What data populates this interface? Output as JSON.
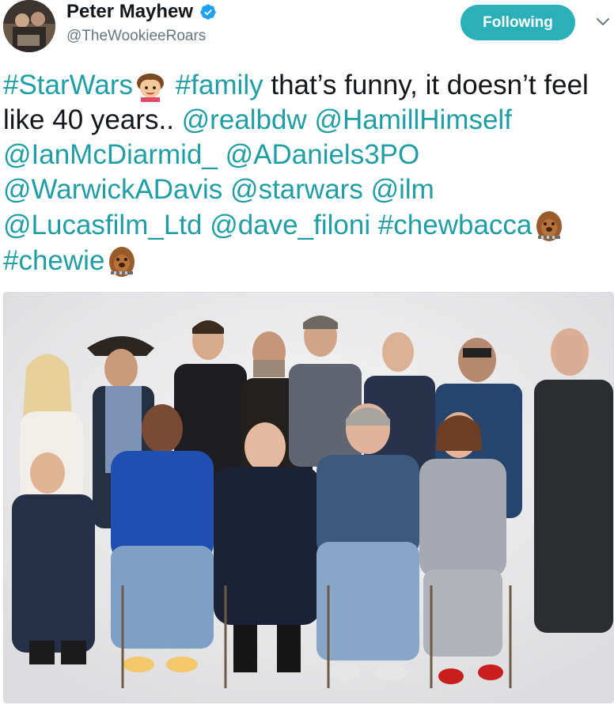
{
  "author": {
    "display_name": "Peter Mayhew",
    "handle": "@TheWookieeRoars",
    "verified": true,
    "avatar_icon": "profile-photo"
  },
  "actions": {
    "follow_label": "Following",
    "more_icon": "chevron-down-icon"
  },
  "tweet": {
    "segments": [
      {
        "type": "hashtag",
        "text": "#StarWars"
      },
      {
        "type": "emoji",
        "name": "boy-emoji"
      },
      {
        "type": "text",
        "text": " "
      },
      {
        "type": "hashtag",
        "text": "#family"
      },
      {
        "type": "text",
        "text": " that’s funny, it doesn’t feel like 40 years.. "
      },
      {
        "type": "mention",
        "text": "@realbdw"
      },
      {
        "type": "text",
        "text": " "
      },
      {
        "type": "mention",
        "text": "@HamillHimself"
      },
      {
        "type": "text",
        "text": " "
      },
      {
        "type": "mention",
        "text": "@IanMcDiarmid_"
      },
      {
        "type": "text",
        "text": " "
      },
      {
        "type": "mention",
        "text": "@ADaniels3PO"
      },
      {
        "type": "text",
        "text": " "
      },
      {
        "type": "mention",
        "text": "@WarwickADavis"
      },
      {
        "type": "text",
        "text": " "
      },
      {
        "type": "mention",
        "text": "@starwars"
      },
      {
        "type": "text",
        "text": " "
      },
      {
        "type": "mention",
        "text": "@ilm"
      },
      {
        "type": "text",
        "text": " "
      },
      {
        "type": "mention",
        "text": "@Lucasfilm_Ltd"
      },
      {
        "type": "text",
        "text": " "
      },
      {
        "type": "mention",
        "text": "@dave_filoni"
      },
      {
        "type": "text",
        "text": " "
      },
      {
        "type": "hashtag",
        "text": "#chewbacca"
      },
      {
        "type": "emoji",
        "name": "chewbacca-emoji"
      },
      {
        "type": "text",
        "text": " "
      },
      {
        "type": "hashtag",
        "text": "#chewie"
      },
      {
        "type": "emoji",
        "name": "chewbacca-emoji"
      }
    ]
  },
  "media": {
    "type": "photo",
    "description_icon": "group-photo"
  },
  "colors": {
    "accent": "#1f9ea6",
    "follow_button": "#2bb0ba",
    "text": "#14171a",
    "secondary": "#657786"
  }
}
